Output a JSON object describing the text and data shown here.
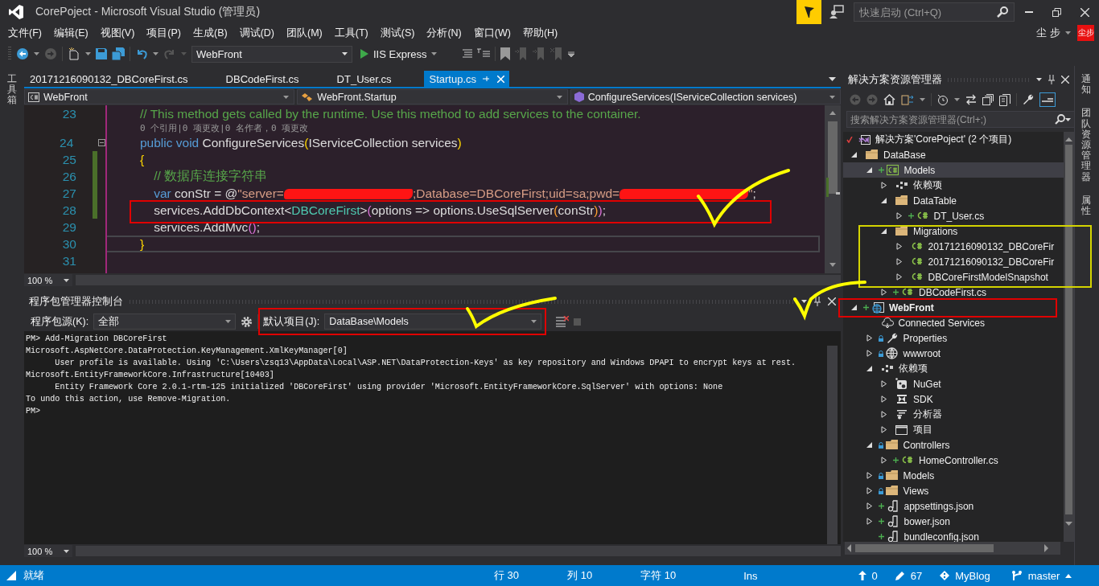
{
  "window": {
    "title": "CorePoject - Microsoft Visual Studio (管理员)"
  },
  "quick_launch": {
    "placeholder": "快速启动 (Ctrl+Q)"
  },
  "menu": [
    "文件(F)",
    "编辑(E)",
    "视图(V)",
    "项目(P)",
    "生成(B)",
    "调试(D)",
    "团队(M)",
    "工具(T)",
    "测试(S)",
    "分析(N)",
    "窗口(W)",
    "帮助(H)"
  ],
  "user": {
    "name": "尘 步",
    "avatar": "尘步"
  },
  "toolbar": {
    "project": "WebFront",
    "run": "IIS Express"
  },
  "left_strip": [
    "工具箱"
  ],
  "tabs": [
    {
      "label": "20171216090132_DBCoreFirst.cs",
      "selected": false
    },
    {
      "label": "DBCodeFirst.cs",
      "selected": false
    },
    {
      "label": "DT_User.cs",
      "selected": false
    },
    {
      "label": "Startup.cs",
      "selected": true
    }
  ],
  "nav": [
    "WebFront",
    "WebFront.Startup",
    "ConfigureServices(IServiceCollection services)"
  ],
  "code_lines": [
    {
      "kind": "code",
      "number": "23",
      "changed": false,
      "current": false,
      "fold": false,
      "tokens": [
        {
          "kind": "comment",
          "t": "// This method gets called by the runtime. Use this method to add services to the container."
        }
      ]
    },
    {
      "kind": "lens",
      "text": "0 个引用|0 项更改|0 名作者，0 项更改"
    },
    {
      "kind": "code",
      "number": "24",
      "changed": false,
      "current": false,
      "fold": true,
      "tokens": [
        {
          "kind": "keyword",
          "t": "public"
        },
        {
          "kind": "keyword",
          "t": " void"
        },
        {
          "kind": "plain",
          "t": " ConfigureServices"
        },
        {
          "kind": "paren",
          "t": "("
        },
        {
          "kind": "plain",
          "t": "IServiceCollection services"
        },
        {
          "kind": "paren",
          "t": ")"
        }
      ]
    },
    {
      "kind": "code",
      "number": "25",
      "changed": true,
      "current": false,
      "fold": false,
      "tokens": [
        {
          "kind": "paren",
          "t": "{"
        }
      ]
    },
    {
      "kind": "code",
      "number": "26",
      "changed": true,
      "current": false,
      "fold": false,
      "tokens": [
        {
          "kind": "comment",
          "t": "    // 数据库连接字符串"
        }
      ]
    },
    {
      "kind": "code",
      "number": "27",
      "changed": true,
      "current": false,
      "fold": false,
      "tokens": [
        {
          "kind": "keyword",
          "t": "    var"
        },
        {
          "kind": "plain",
          "t": " conStr = @"
        },
        {
          "kind": "string",
          "t": "\"server="
        },
        {
          "kind": "redacted"
        },
        {
          "kind": "string",
          "t": ";Database=DBCoreFirst;uid=sa;pwd="
        },
        {
          "kind": "redacted"
        },
        {
          "kind": "string",
          "t": "\""
        },
        {
          "kind": "plain",
          "t": ";"
        }
      ]
    },
    {
      "kind": "code",
      "number": "28",
      "changed": true,
      "current": false,
      "fold": false,
      "tokens": [
        {
          "kind": "plain",
          "t": "    services.AddDbContext<"
        },
        {
          "kind": "type",
          "t": "DBCoreFirst"
        },
        {
          "kind": "plain",
          "t": ">"
        },
        {
          "kind": "paren2",
          "t": "("
        },
        {
          "kind": "plain",
          "t": "options => options.UseSqlServer"
        },
        {
          "kind": "paren3",
          "t": "("
        },
        {
          "kind": "plain",
          "t": "conStr"
        },
        {
          "kind": "paren3",
          "t": ")"
        },
        {
          "kind": "paren2",
          "t": ")"
        },
        {
          "kind": "plain",
          "t": ";"
        }
      ]
    },
    {
      "kind": "code",
      "number": "29",
      "changed": false,
      "current": false,
      "fold": false,
      "tokens": [
        {
          "kind": "plain",
          "t": "    services.AddMvc"
        },
        {
          "kind": "paren2",
          "t": "()"
        },
        {
          "kind": "plain",
          "t": ";"
        }
      ]
    },
    {
      "kind": "code",
      "number": "30",
      "changed": false,
      "current": true,
      "fold": false,
      "tokens": [
        {
          "kind": "paren",
          "t": "}"
        }
      ]
    },
    {
      "kind": "code",
      "number": "31",
      "changed": false,
      "current": false,
      "fold": false
    }
  ],
  "editor_zoom": "100 %",
  "console": {
    "title": "程序包管理器控制台",
    "source_label": "程序包源(K):",
    "source": "全部",
    "project_label": "默认项目(J):",
    "project": "DataBase\\Models",
    "lines": [
      "PM> Add-Migration DBCoreFirst",
      "Microsoft.AspNetCore.DataProtection.KeyManagement.XmlKeyManager[0]",
      "      User profile is available. Using 'C:\\Users\\zsq13\\AppData\\Local\\ASP.NET\\DataProtection-Keys' as key repository and Windows DPAPI to encrypt keys at rest.",
      "Microsoft.EntityFrameworkCore.Infrastructure[10403]",
      "      Entity Framework Core 2.0.1-rtm-125 initialized 'DBCoreFirst' using provider 'Microsoft.EntityFrameworkCore.SqlServer' with options: None",
      "To undo this action, use Remove-Migration.",
      "PM>"
    ],
    "zoom": "100 %"
  },
  "solution_explorer": {
    "title": "解决方案资源管理器",
    "search": {
      "placeholder": "搜索解决方案资源管理器(Ctrl+;)"
    },
    "tree": [
      {
        "label": "解决方案'CorePoject' (2 个项目)",
        "kind": "solution",
        "selected": false,
        "children": [
          {
            "label": "DataBase",
            "kind": "folder",
            "expanded": true,
            "selected": false,
            "children": [
              {
                "label": "Models",
                "kind": "csproj",
                "added": true,
                "expanded": true,
                "selected": true,
                "startup": false,
                "children": [
                  {
                    "label": "依赖项",
                    "kind": "deps",
                    "expanded": false,
                    "selected": false
                  },
                  {
                    "label": "DataTable",
                    "kind": "folder",
                    "expanded": true,
                    "selected": false,
                    "children": [
                      {
                        "label": "DT_User.cs",
                        "kind": "cs",
                        "added": true,
                        "expanded": false,
                        "selected": false
                      }
                    ]
                  },
                  {
                    "label": "Migrations",
                    "kind": "folder",
                    "expanded": true,
                    "selected": false,
                    "children": [
                      {
                        "label": "20171216090132_DBCoreFir",
                        "kind": "cs",
                        "expanded": false,
                        "selected": false
                      },
                      {
                        "label": "20171216090132_DBCoreFir",
                        "kind": "cs",
                        "expanded": false,
                        "selected": false
                      },
                      {
                        "label": "DBCoreFirstModelSnapshot",
                        "kind": "cs",
                        "expanded": false,
                        "selected": false
                      }
                    ]
                  },
                  {
                    "label": "DBCodeFirst.cs",
                    "kind": "cs",
                    "added": true,
                    "expanded": false,
                    "selected": false
                  }
                ]
              }
            ]
          },
          {
            "label": "WebFront",
            "kind": "web",
            "added": true,
            "expanded": true,
            "selected": false,
            "startup": true,
            "children": [
              {
                "label": "Connected Services",
                "kind": "cloud",
                "selected": false
              },
              {
                "label": "Properties",
                "kind": "wrench",
                "locked": true,
                "expanded": false,
                "selected": false
              },
              {
                "label": "wwwroot",
                "kind": "globe",
                "locked": true,
                "expanded": false,
                "selected": false
              },
              {
                "label": "依赖项",
                "kind": "deps",
                "expanded": true,
                "selected": false,
                "children": [
                  {
                    "label": "NuGet",
                    "kind": "nuget",
                    "expanded": false,
                    "selected": false
                  },
                  {
                    "label": "SDK",
                    "kind": "sdk",
                    "expanded": false,
                    "selected": false
                  },
                  {
                    "label": "分析器",
                    "kind": "analyzer",
                    "expanded": false,
                    "selected": false
                  },
                  {
                    "label": "项目",
                    "kind": "project",
                    "expanded": false,
                    "selected": false
                  }
                ]
              },
              {
                "label": "Controllers",
                "kind": "folder",
                "locked": true,
                "expanded": true,
                "selected": false,
                "children": [
                  {
                    "label": "HomeController.cs",
                    "kind": "cs",
                    "added": true,
                    "expanded": false,
                    "selected": false
                  }
                ]
              },
              {
                "label": "Models",
                "kind": "folder",
                "locked": true,
                "expanded": false,
                "selected": false
              },
              {
                "label": "Views",
                "kind": "folder",
                "locked": true,
                "expanded": false,
                "selected": false
              },
              {
                "label": "appsettings.json",
                "kind": "json",
                "added": true,
                "expanded": false,
                "selected": false
              },
              {
                "label": "bower.json",
                "kind": "json",
                "added": true,
                "expanded": false,
                "selected": false
              },
              {
                "label": "bundleconfig.json",
                "kind": "json",
                "added": true,
                "selected": false
              }
            ]
          }
        ]
      }
    ]
  },
  "right_strip": [
    "通知",
    "团队资源管理器",
    "属性"
  ],
  "status_bar": {
    "message": "就绪",
    "line": "行 30",
    "column": "列 10",
    "char": "字符 10",
    "mode": "Ins",
    "push": "0",
    "changes": "67",
    "repo": "MyBlog",
    "branch": "master"
  },
  "annotations": [
    {
      "kind": "frame",
      "color": "#e00000"
    },
    {
      "kind": "frame",
      "color": "#e00000"
    },
    {
      "kind": "frame",
      "color": "#e00000"
    },
    {
      "kind": "frame",
      "color": "#d4d400"
    },
    {
      "kind": "check",
      "color": "#ffff00"
    },
    {
      "kind": "check",
      "color": "#ffff00"
    },
    {
      "kind": "check",
      "color": "#ffff00"
    }
  ]
}
